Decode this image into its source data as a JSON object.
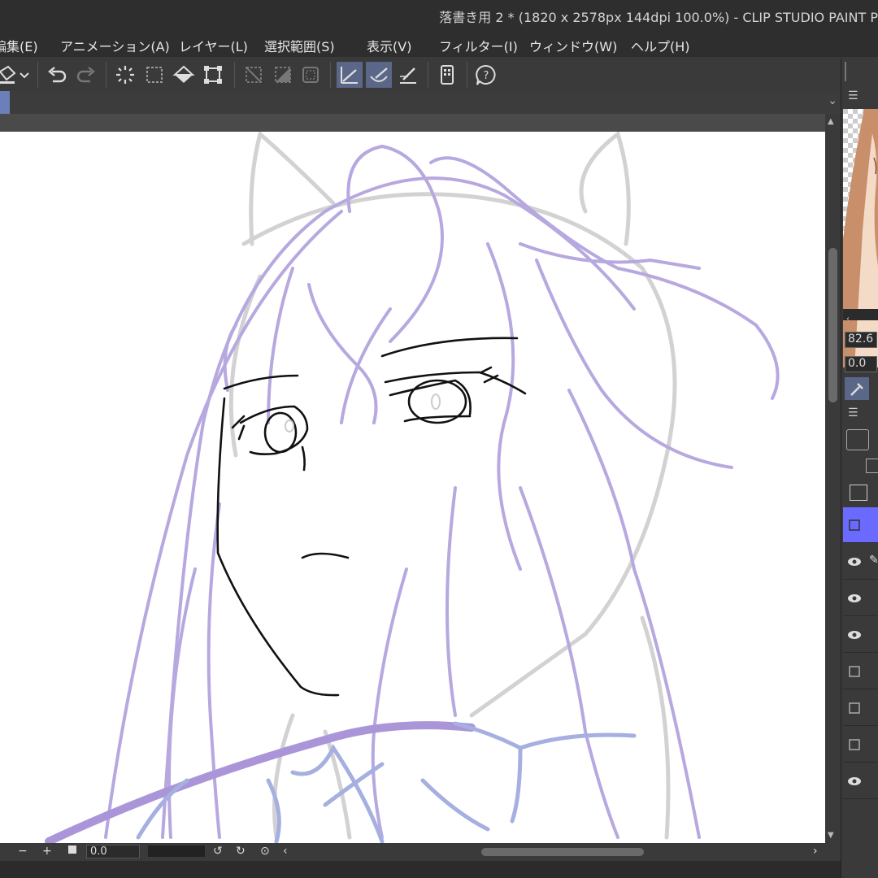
{
  "window": {
    "title": "落書き用 2 * (1820 x 2578px 144dpi 100.0%)  - CLIP STUDIO PAINT P"
  },
  "menu": {
    "items": [
      {
        "label": "編集(E)"
      },
      {
        "label": "アニメーション(A)"
      },
      {
        "label": "レイヤー(L)"
      },
      {
        "label": "選択範囲(S)"
      },
      {
        "label": "表示(V)"
      },
      {
        "label": "フィルター(I)"
      },
      {
        "label": "ウィンドウ(W)"
      },
      {
        "label": "ヘルプ(H)"
      }
    ]
  },
  "toolbar": {
    "icons": [
      "fill-icon",
      "dropdown-chevron-icon",
      "undo-icon",
      "redo-icon",
      "clear-icon",
      "select-all-icon",
      "fill-bucket-icon",
      "transform-icon",
      "deselect-icon",
      "invert-selection-icon",
      "show-selection-icon",
      "ruler-snap-icon",
      "special-ruler-snap-icon",
      "grid-snap-icon",
      "smartphone-icon",
      "help-icon"
    ]
  },
  "status": {
    "rotation_value": "0.0",
    "minus_label": "−",
    "plus_label": "+"
  },
  "right_panel": {
    "zoom_value": "82.6",
    "angle_value": "0.0",
    "layers": [
      {
        "visible": false,
        "selected": true
      },
      {
        "visible": true,
        "selected": false
      },
      {
        "visible": true,
        "selected": false
      },
      {
        "visible": true,
        "selected": false
      },
      {
        "visible": false,
        "selected": false
      },
      {
        "visible": false,
        "selected": false
      },
      {
        "visible": false,
        "selected": false
      },
      {
        "visible": true,
        "selected": false
      }
    ]
  },
  "colors": {
    "accent": "#6a6aff",
    "active_tool": "#5a6788",
    "sketch_purple": "#b7a8e0",
    "sketch_gray": "#d0d0d0",
    "line_black": "#111111"
  }
}
